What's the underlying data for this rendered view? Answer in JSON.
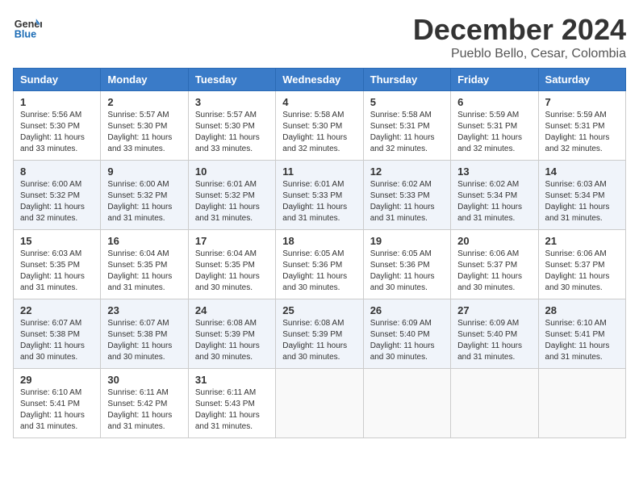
{
  "header": {
    "logo_line1": "General",
    "logo_line2": "Blue",
    "month": "December 2024",
    "location": "Pueblo Bello, Cesar, Colombia"
  },
  "weekdays": [
    "Sunday",
    "Monday",
    "Tuesday",
    "Wednesday",
    "Thursday",
    "Friday",
    "Saturday"
  ],
  "weeks": [
    [
      {
        "day": "1",
        "info": "Sunrise: 5:56 AM\nSunset: 5:30 PM\nDaylight: 11 hours\nand 33 minutes."
      },
      {
        "day": "2",
        "info": "Sunrise: 5:57 AM\nSunset: 5:30 PM\nDaylight: 11 hours\nand 33 minutes."
      },
      {
        "day": "3",
        "info": "Sunrise: 5:57 AM\nSunset: 5:30 PM\nDaylight: 11 hours\nand 33 minutes."
      },
      {
        "day": "4",
        "info": "Sunrise: 5:58 AM\nSunset: 5:30 PM\nDaylight: 11 hours\nand 32 minutes."
      },
      {
        "day": "5",
        "info": "Sunrise: 5:58 AM\nSunset: 5:31 PM\nDaylight: 11 hours\nand 32 minutes."
      },
      {
        "day": "6",
        "info": "Sunrise: 5:59 AM\nSunset: 5:31 PM\nDaylight: 11 hours\nand 32 minutes."
      },
      {
        "day": "7",
        "info": "Sunrise: 5:59 AM\nSunset: 5:31 PM\nDaylight: 11 hours\nand 32 minutes."
      }
    ],
    [
      {
        "day": "8",
        "info": "Sunrise: 6:00 AM\nSunset: 5:32 PM\nDaylight: 11 hours\nand 32 minutes."
      },
      {
        "day": "9",
        "info": "Sunrise: 6:00 AM\nSunset: 5:32 PM\nDaylight: 11 hours\nand 31 minutes."
      },
      {
        "day": "10",
        "info": "Sunrise: 6:01 AM\nSunset: 5:32 PM\nDaylight: 11 hours\nand 31 minutes."
      },
      {
        "day": "11",
        "info": "Sunrise: 6:01 AM\nSunset: 5:33 PM\nDaylight: 11 hours\nand 31 minutes."
      },
      {
        "day": "12",
        "info": "Sunrise: 6:02 AM\nSunset: 5:33 PM\nDaylight: 11 hours\nand 31 minutes."
      },
      {
        "day": "13",
        "info": "Sunrise: 6:02 AM\nSunset: 5:34 PM\nDaylight: 11 hours\nand 31 minutes."
      },
      {
        "day": "14",
        "info": "Sunrise: 6:03 AM\nSunset: 5:34 PM\nDaylight: 11 hours\nand 31 minutes."
      }
    ],
    [
      {
        "day": "15",
        "info": "Sunrise: 6:03 AM\nSunset: 5:35 PM\nDaylight: 11 hours\nand 31 minutes."
      },
      {
        "day": "16",
        "info": "Sunrise: 6:04 AM\nSunset: 5:35 PM\nDaylight: 11 hours\nand 31 minutes."
      },
      {
        "day": "17",
        "info": "Sunrise: 6:04 AM\nSunset: 5:35 PM\nDaylight: 11 hours\nand 30 minutes."
      },
      {
        "day": "18",
        "info": "Sunrise: 6:05 AM\nSunset: 5:36 PM\nDaylight: 11 hours\nand 30 minutes."
      },
      {
        "day": "19",
        "info": "Sunrise: 6:05 AM\nSunset: 5:36 PM\nDaylight: 11 hours\nand 30 minutes."
      },
      {
        "day": "20",
        "info": "Sunrise: 6:06 AM\nSunset: 5:37 PM\nDaylight: 11 hours\nand 30 minutes."
      },
      {
        "day": "21",
        "info": "Sunrise: 6:06 AM\nSunset: 5:37 PM\nDaylight: 11 hours\nand 30 minutes."
      }
    ],
    [
      {
        "day": "22",
        "info": "Sunrise: 6:07 AM\nSunset: 5:38 PM\nDaylight: 11 hours\nand 30 minutes."
      },
      {
        "day": "23",
        "info": "Sunrise: 6:07 AM\nSunset: 5:38 PM\nDaylight: 11 hours\nand 30 minutes."
      },
      {
        "day": "24",
        "info": "Sunrise: 6:08 AM\nSunset: 5:39 PM\nDaylight: 11 hours\nand 30 minutes."
      },
      {
        "day": "25",
        "info": "Sunrise: 6:08 AM\nSunset: 5:39 PM\nDaylight: 11 hours\nand 30 minutes."
      },
      {
        "day": "26",
        "info": "Sunrise: 6:09 AM\nSunset: 5:40 PM\nDaylight: 11 hours\nand 30 minutes."
      },
      {
        "day": "27",
        "info": "Sunrise: 6:09 AM\nSunset: 5:40 PM\nDaylight: 11 hours\nand 31 minutes."
      },
      {
        "day": "28",
        "info": "Sunrise: 6:10 AM\nSunset: 5:41 PM\nDaylight: 11 hours\nand 31 minutes."
      }
    ],
    [
      {
        "day": "29",
        "info": "Sunrise: 6:10 AM\nSunset: 5:41 PM\nDaylight: 11 hours\nand 31 minutes."
      },
      {
        "day": "30",
        "info": "Sunrise: 6:11 AM\nSunset: 5:42 PM\nDaylight: 11 hours\nand 31 minutes."
      },
      {
        "day": "31",
        "info": "Sunrise: 6:11 AM\nSunset: 5:43 PM\nDaylight: 11 hours\nand 31 minutes."
      },
      {
        "day": "",
        "info": ""
      },
      {
        "day": "",
        "info": ""
      },
      {
        "day": "",
        "info": ""
      },
      {
        "day": "",
        "info": ""
      }
    ]
  ]
}
